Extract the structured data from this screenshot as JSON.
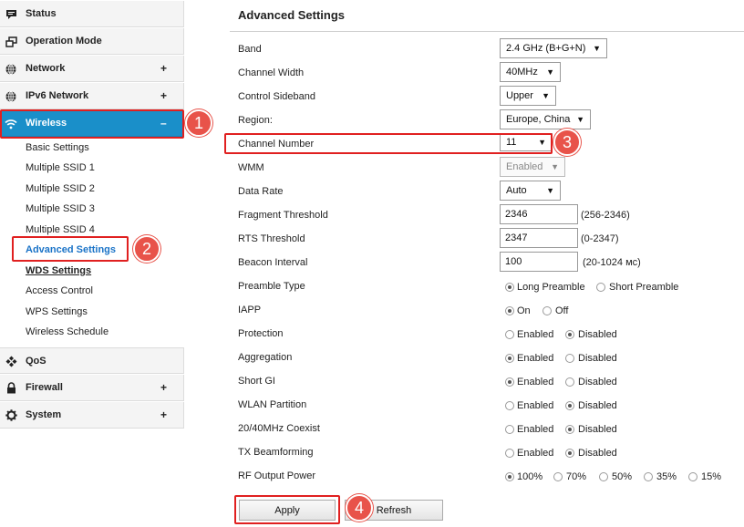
{
  "sidebar": {
    "nav": [
      {
        "label": "Status",
        "icon": "status-icon",
        "expander": ""
      },
      {
        "label": "Operation Mode",
        "icon": "operation-mode-icon",
        "expander": ""
      },
      {
        "label": "Network",
        "icon": "globe-icon",
        "expander": "+"
      },
      {
        "label": "IPv6 Network",
        "icon": "globe-icon",
        "expander": "+"
      },
      {
        "label": "Wireless",
        "icon": "wifi-icon",
        "expander": "–"
      },
      {
        "label": "QoS",
        "icon": "qos-icon",
        "expander": ""
      },
      {
        "label": "Firewall",
        "icon": "lock-icon",
        "expander": "+"
      },
      {
        "label": "System",
        "icon": "gear-icon",
        "expander": "+"
      }
    ],
    "wireless_sub": [
      "Basic Settings",
      "Multiple SSID 1",
      "Multiple SSID 2",
      "Multiple SSID 3",
      "Multiple SSID 4",
      "Advanced Settings",
      "WDS Settings",
      "Access Control",
      "WPS Settings",
      "Wireless Schedule"
    ],
    "active_color": "#1a8fc9"
  },
  "main": {
    "title": "Advanced Settings",
    "band": {
      "label": "Band",
      "value": "2.4 GHz (B+G+N)"
    },
    "channel_width": {
      "label": "Channel Width",
      "value": "40MHz"
    },
    "control_sideband": {
      "label": "Control Sideband",
      "value": "Upper"
    },
    "region": {
      "label": "Region:",
      "value": "Europe, China"
    },
    "channel_number": {
      "label": "Channel Number",
      "value": "11"
    },
    "wmm": {
      "label": "WMM",
      "value": "Enabled"
    },
    "data_rate": {
      "label": "Data Rate",
      "value": "Auto"
    },
    "fragment_threshold": {
      "label": "Fragment Threshold",
      "value": "2346",
      "hint": "(256-2346)"
    },
    "rts_threshold": {
      "label": "RTS Threshold",
      "value": "2347",
      "hint": "(0-2347)"
    },
    "beacon_interval": {
      "label": "Beacon Interval",
      "value": "100",
      "hint": "(20-1024 мс)"
    },
    "preamble": {
      "label": "Preamble Type",
      "options": [
        "Long Preamble",
        "Short Preamble"
      ],
      "selected": 0
    },
    "iapp": {
      "label": "IAPP",
      "options": [
        "On",
        "Off"
      ],
      "selected": 0
    },
    "protection": {
      "label": "Protection",
      "options": [
        "Enabled",
        "Disabled"
      ],
      "selected": 1
    },
    "aggregation": {
      "label": "Aggregation",
      "options": [
        "Enabled",
        "Disabled"
      ],
      "selected": 0
    },
    "short_gi": {
      "label": "Short GI",
      "options": [
        "Enabled",
        "Disabled"
      ],
      "selected": 0
    },
    "wlan_partition": {
      "label": "WLAN Partition",
      "options": [
        "Enabled",
        "Disabled"
      ],
      "selected": 1
    },
    "coexist": {
      "label": "20/40MHz Coexist",
      "options": [
        "Enabled",
        "Disabled"
      ],
      "selected": 1
    },
    "tx_beamforming": {
      "label": "TX Beamforming",
      "options": [
        "Enabled",
        "Disabled"
      ],
      "selected": 1
    },
    "rf_output_power": {
      "label": "RF Output Power",
      "options": [
        "100%",
        "70%",
        "50%",
        "35%",
        "15%"
      ],
      "selected": 0
    },
    "apply_label": "Apply",
    "refresh_label": "Refresh"
  },
  "annotations": {
    "steps": [
      "1",
      "2",
      "3",
      "4"
    ],
    "highlight_color": "#e02020",
    "badge_color": "#e8534a"
  }
}
